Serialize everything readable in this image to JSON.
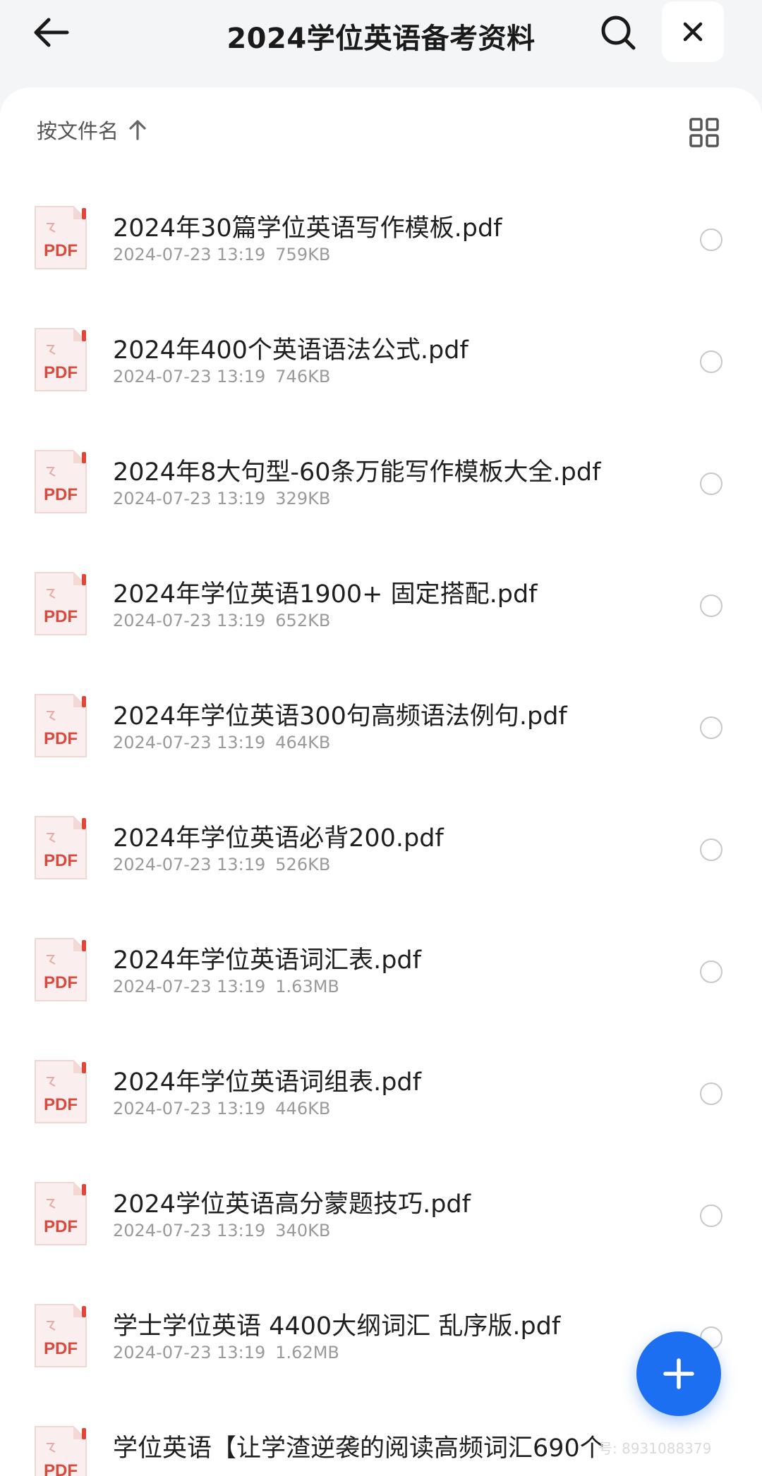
{
  "header": {
    "title": "2024学位英语备考资料",
    "back_icon": "arrow-left-icon",
    "search_icon": "search-icon",
    "close_icon": "close-icon"
  },
  "toolbar": {
    "sort_label": "按文件名",
    "sort_icon": "arrow-up-icon",
    "view_icon": "grid-view-icon"
  },
  "files": [
    {
      "name": "2024年30篇学位英语写作模板.pdf",
      "date": "2024-07-23 13:19",
      "size": "759KB"
    },
    {
      "name": "2024年400个英语语法公式.pdf",
      "date": "2024-07-23 13:19",
      "size": "746KB"
    },
    {
      "name": "2024年8大句型-60条万能写作模板大全.pdf",
      "date": "2024-07-23 13:19",
      "size": "329KB"
    },
    {
      "name": "2024年学位英语1900+ 固定搭配.pdf",
      "date": "2024-07-23 13:19",
      "size": "652KB"
    },
    {
      "name": "2024年学位英语300句高频语法例句.pdf",
      "date": "2024-07-23 13:19",
      "size": "464KB"
    },
    {
      "name": "2024年学位英语必背200.pdf",
      "date": "2024-07-23 13:19",
      "size": "526KB"
    },
    {
      "name": "2024年学位英语词汇表.pdf",
      "date": "2024-07-23 13:19",
      "size": "1.63MB"
    },
    {
      "name": "2024年学位英语词组表.pdf",
      "date": "2024-07-23 13:19",
      "size": "446KB"
    },
    {
      "name": "2024学位英语高分蒙题技巧.pdf",
      "date": "2024-07-23 13:19",
      "size": "340KB"
    },
    {
      "name": "学士学位英语 4400大纲词汇 乱序版.pdf",
      "date": "2024-07-23 13:19",
      "size": "1.62MB"
    },
    {
      "name": "学位英语【让学渣逆袭的阅读高频词汇690个",
      "date": "",
      "size": ""
    }
  ],
  "file_icon_label": "PDF",
  "fab": {
    "icon": "plus-icon"
  },
  "watermark": "号: 8931088379",
  "colors": {
    "accent": "#1d6ff2",
    "pdf_red": "#d94a3c"
  }
}
